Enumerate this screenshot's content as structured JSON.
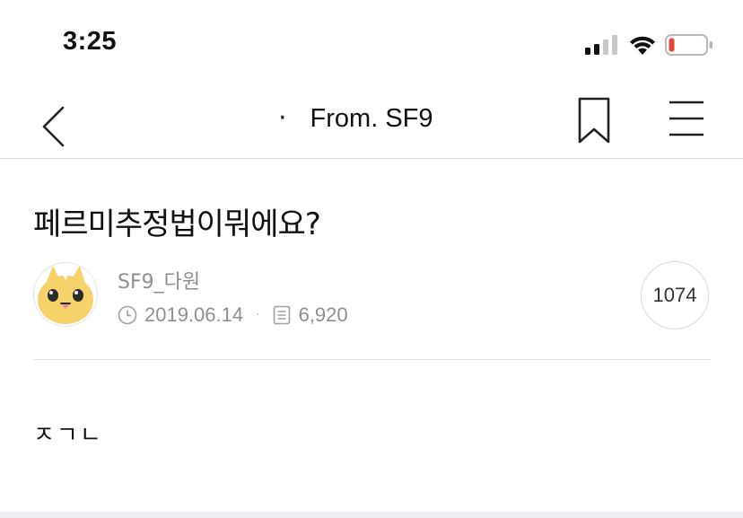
{
  "status_bar": {
    "time": "3:25",
    "signal_icon": "cellular-signal-icon",
    "wifi_icon": "wifi-icon",
    "battery_icon": "battery-low-icon",
    "battery_color": "#e5453a"
  },
  "nav": {
    "back_icon": "chevron-left-icon",
    "title_dot": "·",
    "title": "From. SF9",
    "bookmark_icon": "bookmark-icon",
    "menu_icon": "hamburger-menu-icon"
  },
  "post": {
    "title": "페르미추정법이뭐에요?",
    "author": "SF9_다원",
    "date": "2019.06.14",
    "meta_separator": "·",
    "views": "6,920",
    "comment_count": "1074",
    "body": "ㅈㄱㄴ"
  },
  "colors": {
    "meta_gray": "#8f8f8f",
    "divider": "#e2e2e2",
    "avatar_yellow": "#f7d26a"
  }
}
